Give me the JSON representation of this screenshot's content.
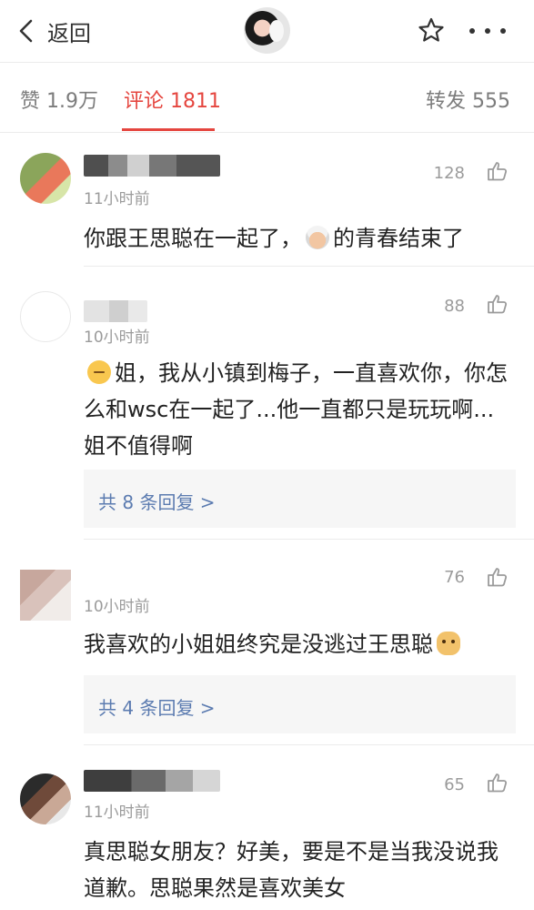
{
  "topbar": {
    "back_label": "返回"
  },
  "tabs": {
    "like": "赞 1.9万",
    "comment": "评论 1811",
    "repost": "转发 555"
  },
  "comments": [
    {
      "time": "11小时前",
      "likes": "128",
      "text": "你跟王思聪在一起了，",
      "text_after": "的青春结束了"
    },
    {
      "time": "10小时前",
      "likes": "88",
      "text": "姐，我从小镇到梅子，一直喜欢你，你怎么和wsc在一起了...他一直都只是玩玩啊...姐不值得啊",
      "reply": "共 8 条回复 >"
    },
    {
      "time": "10小时前",
      "likes": "76",
      "text": "我喜欢的小姐姐终究是没逃过王思聪",
      "reply": "共 4 条回复 >"
    },
    {
      "time": "11小时前",
      "likes": "65",
      "text": "真思聪女朋友？好美，要是不是当我没说我道歉。思聪果然是喜欢美女"
    }
  ]
}
